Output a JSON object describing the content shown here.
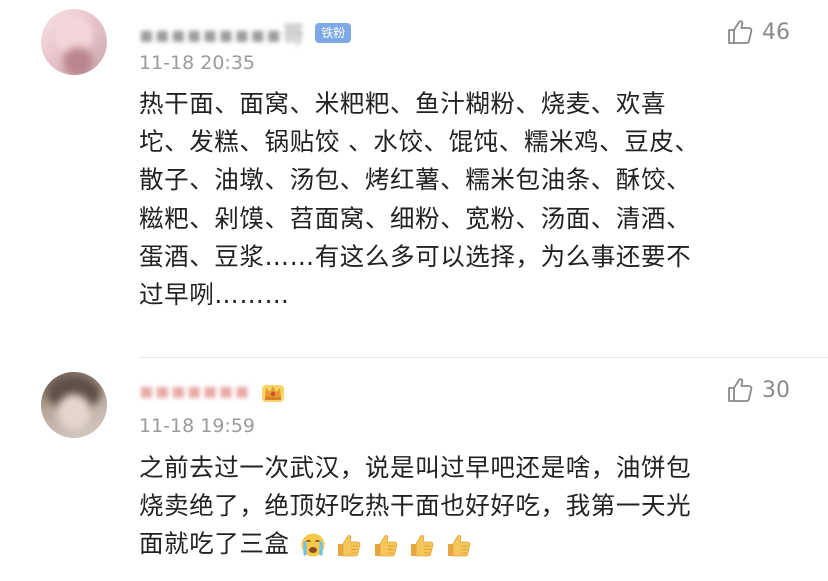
{
  "comments": [
    {
      "username": "▪▪▪▪▪▪▪▪▪哥",
      "badge": "铁粉",
      "timestamp": "11-18 20:35",
      "likes": "46",
      "lines": [
        "热干面、面窝、米粑粑、鱼汁糊粉、烧麦、欢喜",
        "坨、发糕、锅贴饺 、水饺、馄饨、糯米鸡、豆皮、",
        "散子、油墩、汤包、烤红薯、糯米包油条、酥饺、",
        "糍粑、剁馍、苕面窝、细粉、宽粉、汤面、清酒、",
        "蛋酒、豆浆……有这么多可以选择，为么事还要不",
        "过早咧………"
      ]
    },
    {
      "username": "▪▪▪▪▪▪▪",
      "badge_icon": "crown-icon",
      "timestamp": "11-18 19:59",
      "likes": "30",
      "lines": [
        "之前去过一次武汉，说是叫过早吧还是啥，油饼包",
        "烧卖绝了，绝顶好吃热干面也好好吃，我第一天光",
        "面就吃了三盒"
      ],
      "emojis": [
        "crying-face-icon",
        "thumbs-up-icon",
        "thumbs-up-icon",
        "thumbs-up-icon",
        "thumbs-up-icon"
      ]
    }
  ],
  "colors": {
    "badge_bg": "#7ea8e8",
    "meta_text": "#9b9b9b",
    "body_text": "#222222",
    "divider": "#e6e6e6"
  }
}
